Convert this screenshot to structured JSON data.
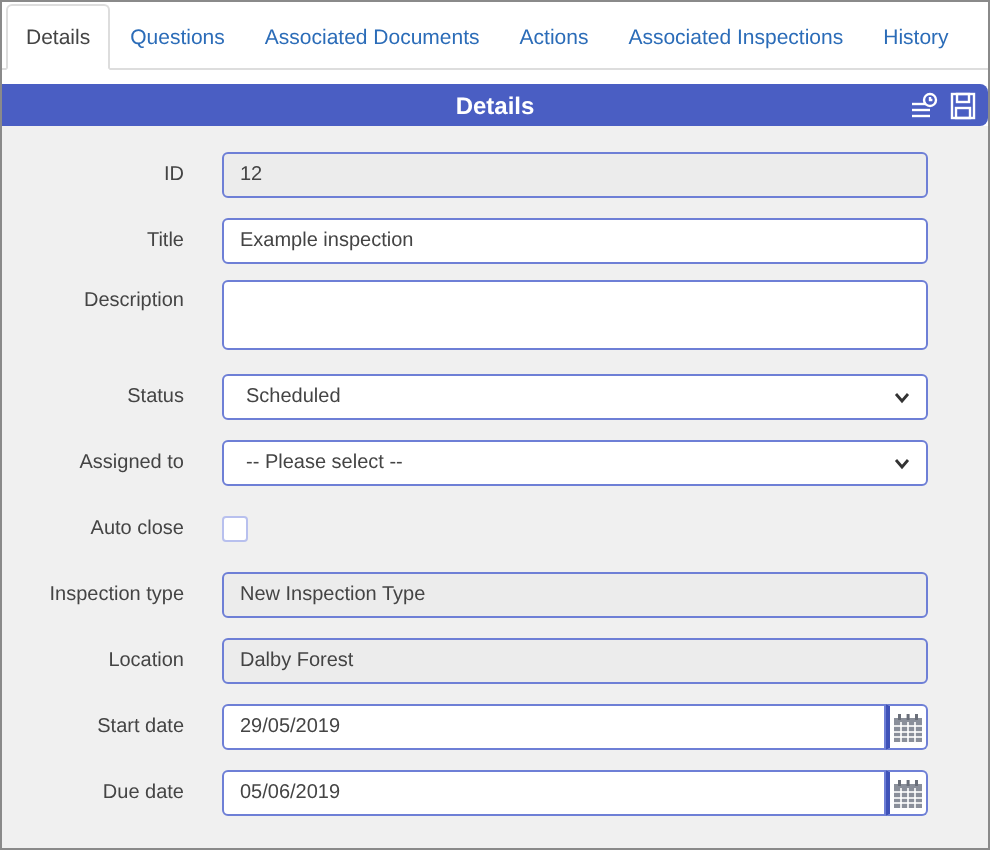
{
  "tabs": [
    {
      "label": "Details",
      "selected": true
    },
    {
      "label": "Questions",
      "selected": false
    },
    {
      "label": "Associated Documents",
      "selected": false
    },
    {
      "label": "Actions",
      "selected": false
    },
    {
      "label": "Associated Inspections",
      "selected": false
    },
    {
      "label": "History",
      "selected": false
    }
  ],
  "panel": {
    "title": "Details"
  },
  "fields": [
    {
      "label": "ID",
      "kind": "readonly",
      "value": "12"
    },
    {
      "label": "Title",
      "kind": "text",
      "value": "Example inspection"
    },
    {
      "label": "Description",
      "kind": "textarea"
    },
    {
      "label": "Status",
      "kind": "select",
      "value": "Scheduled"
    },
    {
      "label": "Assigned to",
      "kind": "select",
      "value": "-- Please select --"
    },
    {
      "label": "Auto close",
      "kind": "checkbox",
      "checked": false
    },
    {
      "label": "Inspection type",
      "kind": "readonly",
      "value": "New Inspection Type"
    },
    {
      "label": "Location",
      "kind": "readonly",
      "value": "Dalby Forest"
    },
    {
      "label": "Start date",
      "kind": "date",
      "value": "29/05/2019"
    },
    {
      "label": "Due date",
      "kind": "date",
      "value": "05/06/2019"
    }
  ]
}
